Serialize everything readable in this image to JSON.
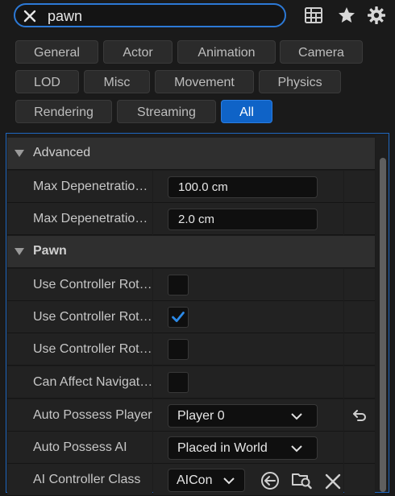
{
  "search": {
    "value": "pawn"
  },
  "filters": [
    "General",
    "Actor",
    "Animation",
    "Camera",
    "LOD",
    "Misc",
    "Movement",
    "Physics",
    "Rendering",
    "Streaming",
    "All"
  ],
  "active_filter": "All",
  "categories": {
    "advanced": "Advanced",
    "pawn": "Pawn"
  },
  "rows": [
    {
      "label": "Max Depenetratio…",
      "value": "100.0 cm"
    },
    {
      "label": "Max Depenetratio…",
      "value": "2.0 cm"
    },
    {
      "label": "Use Controller Rot…",
      "checked": false
    },
    {
      "label": "Use Controller Rot…",
      "checked": true
    },
    {
      "label": "Use Controller Rot…",
      "checked": false
    },
    {
      "label": "Can Affect Navigat…",
      "checked": false
    },
    {
      "label": "Auto Possess Player",
      "value": "Player 0"
    },
    {
      "label": "Auto Possess AI",
      "value": "Placed in World"
    },
    {
      "label": "AI Controller Class",
      "value": "AICon"
    }
  ],
  "colors": {
    "accent": "#0f63c7",
    "check": "#2c8ae8"
  }
}
